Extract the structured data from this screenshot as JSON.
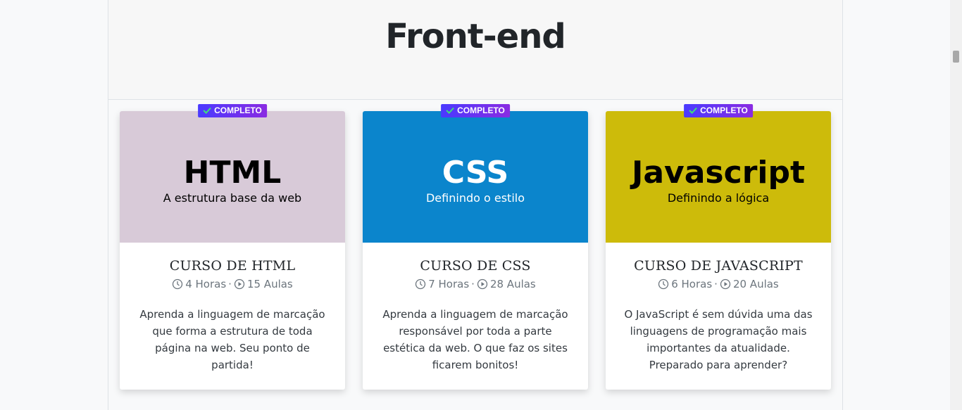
{
  "header": {
    "title": "Front-end"
  },
  "badge_label": "COMPLETO",
  "courses": [
    {
      "banner_title": "HTML",
      "banner_subtitle": "A estrutura base da web",
      "banner_bg": "#d8cad8",
      "banner_fg": "#000000",
      "name": "CURSO DE HTML",
      "hours": "4 Horas",
      "lessons": "15 Aulas",
      "description": "Aprenda a linguagem de marcação que forma a estrutura de toda página na web. Seu ponto de partida!"
    },
    {
      "banner_title": "CSS",
      "banner_subtitle": "Definindo o estilo",
      "banner_bg": "#0b85cc",
      "banner_fg": "#ffffff",
      "name": "CURSO DE CSS",
      "hours": "7 Horas",
      "lessons": "28 Aulas",
      "description": "Aprenda a linguagem de marcação responsável por toda a parte estética da web. O que faz os sites ficarem bonitos!"
    },
    {
      "banner_title": "Javascript",
      "banner_subtitle": "Definindo a lógica",
      "banner_bg": "#cdbb0a",
      "banner_fg": "#000000",
      "name": "CURSO DE JAVASCRIPT",
      "hours": "6 Horas",
      "lessons": "20 Aulas",
      "description": "O JavaScript é sem dúvida uma das linguagens de programação mais importantes da atualidade. Preparado para aprender?"
    }
  ]
}
